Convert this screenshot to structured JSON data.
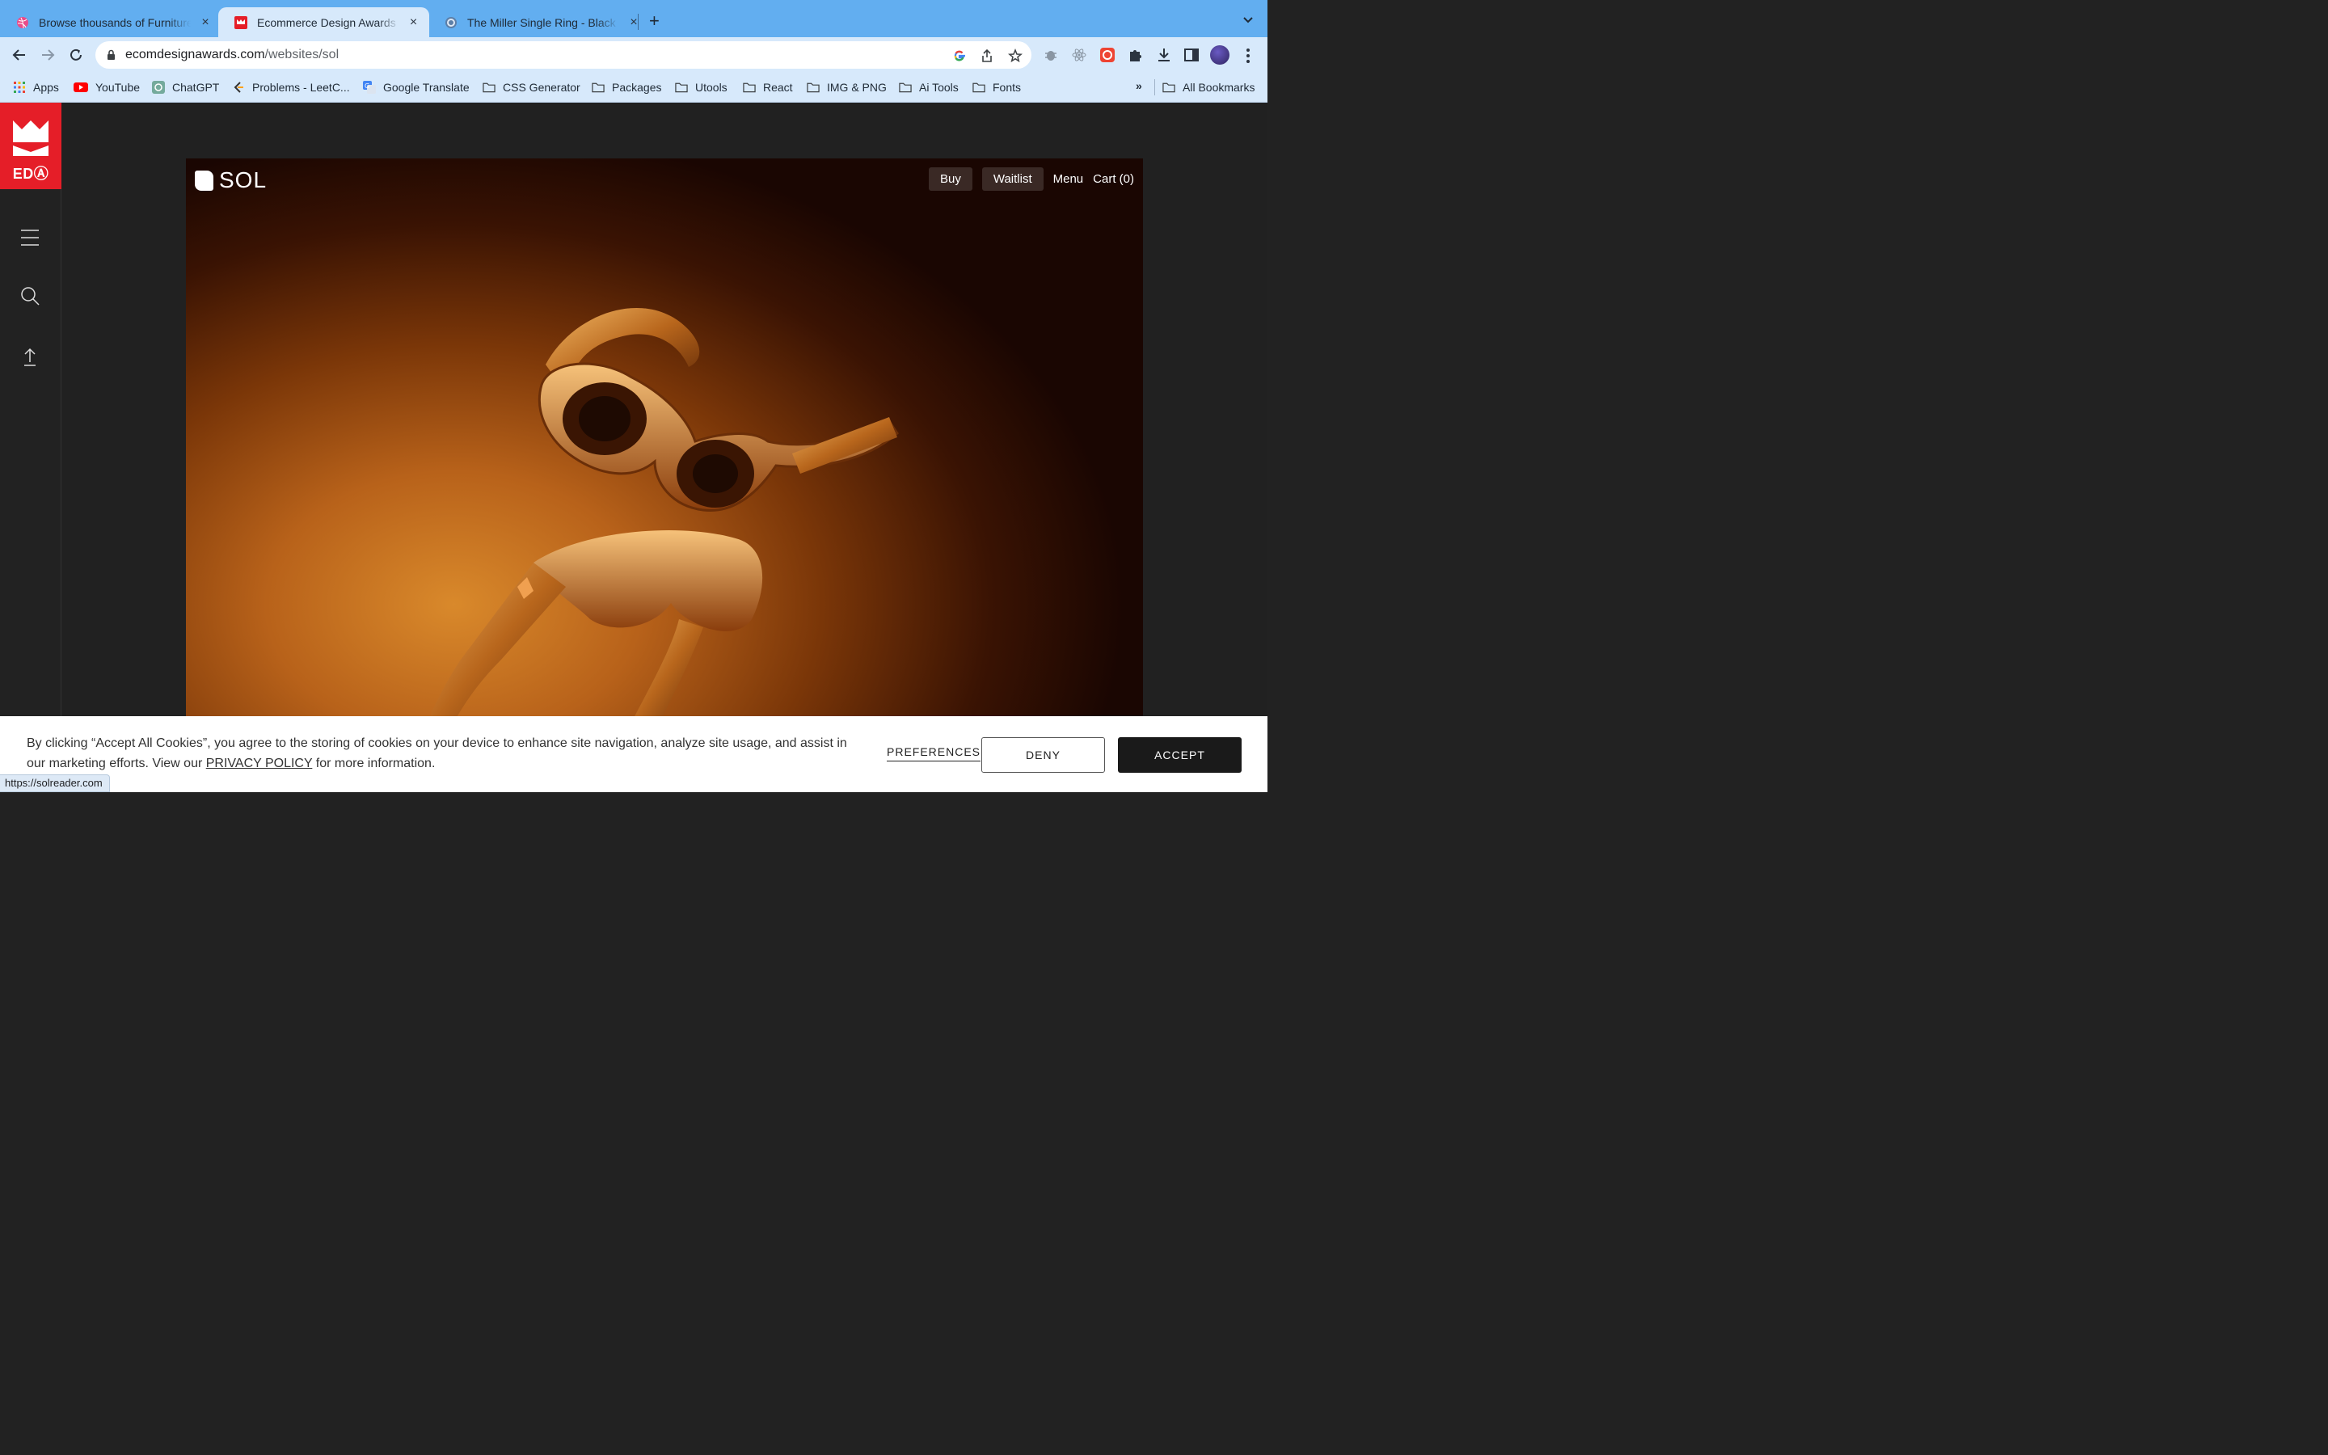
{
  "browser": {
    "tabs": [
      {
        "title": "Browse thousands of Furniture",
        "icon": "dribbble-icon",
        "active": false
      },
      {
        "title": "Ecommerce Design Awards | W",
        "icon": "eda-crown-icon",
        "active": true
      },
      {
        "title": "The Miller Single Ring - Black",
        "icon": "ring-site-icon",
        "active": false
      }
    ],
    "new_tab_label": "+",
    "close_label": "×",
    "url": {
      "host": "ecomdesignawards.com",
      "path": "/websites/sol"
    },
    "bookmarks": [
      {
        "label": "Apps",
        "icon": "apps-grid-icon"
      },
      {
        "label": "YouTube",
        "icon": "youtube-icon"
      },
      {
        "label": "ChatGPT",
        "icon": "chatgpt-icon"
      },
      {
        "label": "Problems - LeetC...",
        "icon": "leetcode-icon"
      },
      {
        "label": "Google Translate",
        "icon": "google-translate-icon"
      },
      {
        "label": "CSS Generator",
        "icon": "folder-icon"
      },
      {
        "label": "Packages",
        "icon": "folder-icon"
      },
      {
        "label": "Utools",
        "icon": "folder-icon"
      },
      {
        "label": "React",
        "icon": "folder-icon"
      },
      {
        "label": "IMG & PNG",
        "icon": "folder-icon"
      },
      {
        "label": "Ai Tools",
        "icon": "folder-icon"
      },
      {
        "label": "Fonts",
        "icon": "folder-icon"
      }
    ],
    "bookmarks_overflow": "»",
    "all_bookmarks": "All Bookmarks",
    "status_url": "https://solreader.com"
  },
  "eda": {
    "logo_text": "EDⒶ",
    "brand_color": "#e51e28"
  },
  "sol_site": {
    "logo": "SOL",
    "nav": {
      "buy": "Buy",
      "waitlist": "Waitlist",
      "menu": "Menu",
      "cart": "Cart (0)"
    }
  },
  "cookie_banner": {
    "text_before": "By clicking “Accept All Cookies”, you agree to the storing of cookies on your device to enhance site navigation, analyze site usage, and assist in our marketing efforts. View our ",
    "privacy_link": "PRIVACY POLICY",
    "text_after": " for more information.",
    "preferences": "PREFERENCES",
    "deny": "DENY",
    "accept": "ACCEPT"
  }
}
